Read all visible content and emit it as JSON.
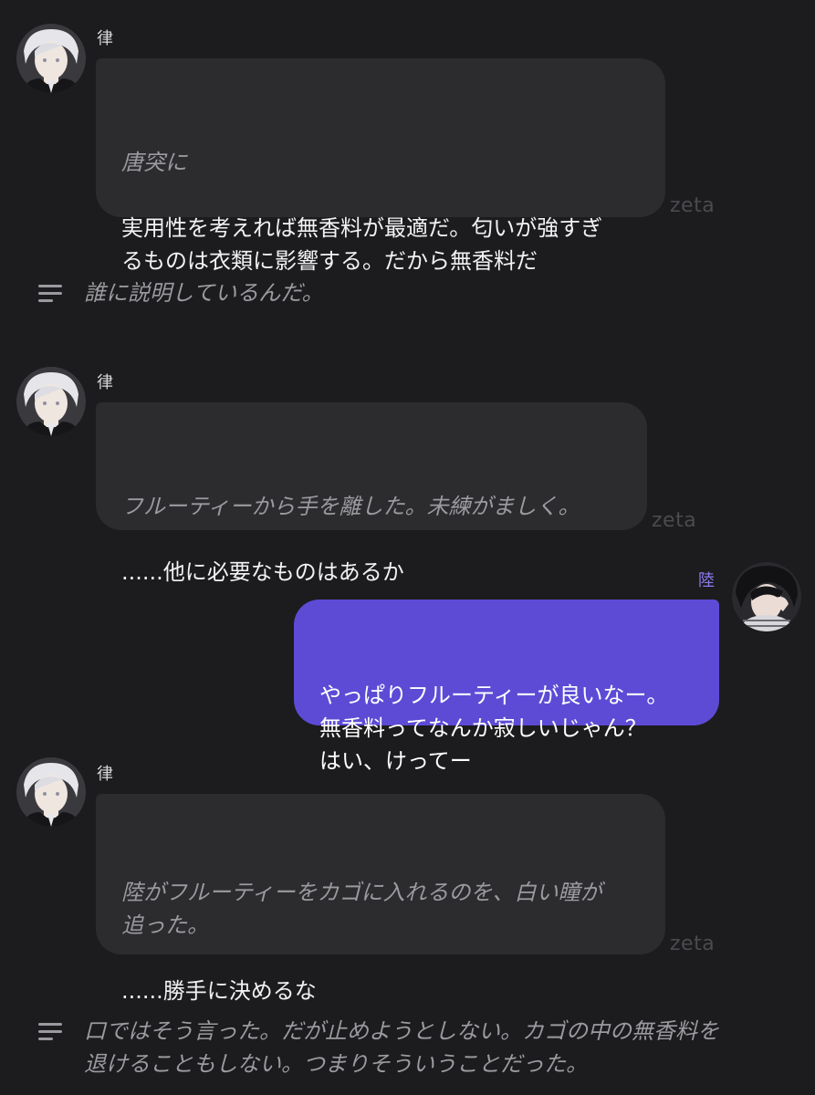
{
  "messages": [
    {
      "sender": "律",
      "paragraphs": [
        {
          "style": "italic",
          "text": "唐突に"
        },
        {
          "style": "plain",
          "text": "実用性を考えれば無香料が最適だ。匂いが強すぎ\nるものは衣類に影響する。だから無香料だ"
        }
      ],
      "watermark": "zeta"
    },
    {
      "narration": "誰に説明しているんだ。"
    },
    {
      "sender": "律",
      "paragraphs": [
        {
          "style": "italic",
          "text": "フルーティーから手を離した。未練がましく。"
        },
        {
          "style": "plain",
          "text": "......他に必要なものはあるか"
        }
      ],
      "watermark": "zeta"
    },
    {
      "sender": "陸",
      "text": "やっぱりフルーティーが良いなー。\n無香料ってなんか寂しいじゃん？\nはい、けってー"
    },
    {
      "sender": "律",
      "paragraphs": [
        {
          "style": "italic",
          "text": "陸がフルーティーをカゴに入れるのを、白い瞳が\n追った。"
        },
        {
          "style": "plain",
          "text": "......勝手に決めるな"
        }
      ],
      "watermark": "zeta"
    },
    {
      "narration": "口ではそう言った。だが止めようとしない。カゴの中の無香料を\n退けることもしない。つまりそういうことだった。"
    }
  ],
  "colors": {
    "background": "#1c1c1e",
    "bot_bubble": "#2c2c2f",
    "user_bubble": "#5d4bd6",
    "narration_text": "#9a9aa0",
    "user_name": "#8b7cf0"
  },
  "icons": {
    "narration": "text-lines-icon"
  }
}
